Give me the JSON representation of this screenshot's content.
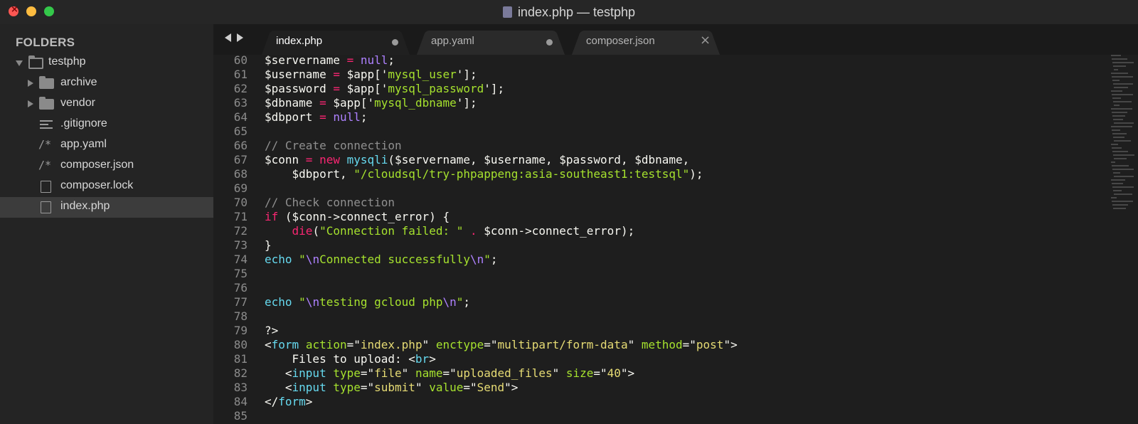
{
  "window": {
    "title": "index.php — testphp"
  },
  "sidebar": {
    "heading": "FOLDERS",
    "items": [
      {
        "label": "testphp",
        "kind": "folder-open"
      },
      {
        "label": "archive",
        "kind": "folder"
      },
      {
        "label": "vendor",
        "kind": "folder"
      },
      {
        "label": ".gitignore",
        "kind": "text-file"
      },
      {
        "label": "app.yaml",
        "kind": "comment-file"
      },
      {
        "label": "composer.json",
        "kind": "comment-file"
      },
      {
        "label": "composer.lock",
        "kind": "file"
      },
      {
        "label": "index.php",
        "kind": "file",
        "selected": true
      }
    ],
    "comment_glyph": "/*"
  },
  "tabs": [
    {
      "label": "index.php",
      "active": true,
      "dirty": true
    },
    {
      "label": "app.yaml",
      "active": false,
      "dirty": true
    },
    {
      "label": "composer.json",
      "active": false,
      "close": "×"
    }
  ],
  "editor": {
    "lines": [
      {
        "n": "60",
        "text": "$servername = null;"
      },
      {
        "n": "61",
        "text": "$username = $app['mysql_user'];"
      },
      {
        "n": "62",
        "text": "$password = $app['mysql_password'];"
      },
      {
        "n": "63",
        "text": "$dbname = $app['mysql_dbname'];"
      },
      {
        "n": "64",
        "text": "$dbport = null;"
      },
      {
        "n": "65",
        "text": ""
      },
      {
        "n": "66",
        "text": "// Create connection"
      },
      {
        "n": "67",
        "text": "$conn = new mysqli($servername, $username, $password, $dbname,"
      },
      {
        "n": "68",
        "text": "    $dbport, \"/cloudsql/try-phpappeng:asia-southeast1:testsql\");"
      },
      {
        "n": "69",
        "text": ""
      },
      {
        "n": "70",
        "text": "// Check connection"
      },
      {
        "n": "71",
        "text": "if ($conn->connect_error) {"
      },
      {
        "n": "72",
        "text": "    die(\"Connection failed: \" . $conn->connect_error);"
      },
      {
        "n": "73",
        "text": "}"
      },
      {
        "n": "74",
        "text": "echo \"\\nConnected successfully\\n\";"
      },
      {
        "n": "75",
        "text": ""
      },
      {
        "n": "76",
        "text": ""
      },
      {
        "n": "77",
        "text": "echo \"\\ntesting gcloud php\\n\";"
      },
      {
        "n": "78",
        "text": ""
      },
      {
        "n": "79",
        "text": "?>"
      },
      {
        "n": "80",
        "text": "<form action=\"index.php\" enctype=\"multipart/form-data\" method=\"post\">"
      },
      {
        "n": "81",
        "text": "    Files to upload: <br>"
      },
      {
        "n": "82",
        "text": "   <input type=\"file\" name=\"uploaded_files\" size=\"40\">"
      },
      {
        "n": "83",
        "text": "   <input type=\"submit\" value=\"Send\">"
      },
      {
        "n": "84",
        "text": "</form>"
      },
      {
        "n": "85",
        "text": ""
      }
    ]
  },
  "colors": {
    "keyword": "#f92672",
    "string": "#a6e22e",
    "constant": "#ae81ff",
    "comment": "#8f8f8f",
    "function": "#66d9ef",
    "background": "#1e1e1e"
  }
}
